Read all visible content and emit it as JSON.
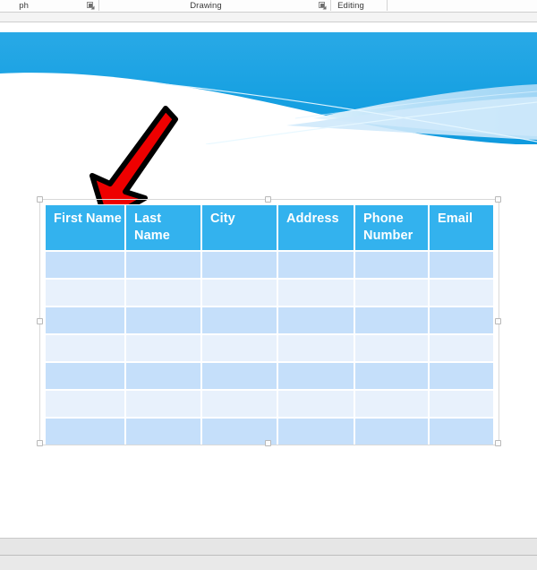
{
  "ribbon": {
    "groups": [
      {
        "label": "ph",
        "full_label": "Paragraph",
        "has_dialog_launcher": true
      },
      {
        "label": "Drawing",
        "full_label": "Drawing",
        "has_dialog_launcher": true
      },
      {
        "label": "Editing",
        "full_label": "Editing",
        "has_dialog_launcher": false
      }
    ],
    "dialog_launcher_icon": "dialog-box-launcher-icon"
  },
  "slide": {
    "theme_name": "blue-wave-banner",
    "background_color": "#ffffff",
    "banner": {
      "accent_color": "#1aa3e0",
      "accent_color_dark": "#0d97da",
      "accent_color_light": "#9fd5f5",
      "accent_color_pale": "#cfe9fb",
      "line_color": "#eaf7ff"
    },
    "annotation": {
      "shape": "arrow-down-left",
      "fill_color": "#ee0000",
      "outline_color": "#000000",
      "points_at": "First Name header cell"
    },
    "table": {
      "selected": true,
      "header_background": "#33b2ee",
      "header_text_color": "#ffffff",
      "band_dark": "#c5dffa",
      "band_light": "#e8f1fc",
      "gridline_color": "#ffffff",
      "headers": [
        "First Name",
        "Last Name",
        "City",
        "Address",
        "Phone Number",
        "Email"
      ],
      "rows": [
        [
          "",
          "",
          "",
          "",
          "",
          ""
        ],
        [
          "",
          "",
          "",
          "",
          "",
          ""
        ],
        [
          "",
          "",
          "",
          "",
          "",
          ""
        ],
        [
          "",
          "",
          "",
          "",
          "",
          ""
        ],
        [
          "",
          "",
          "",
          "",
          "",
          ""
        ],
        [
          "",
          "",
          "",
          "",
          "",
          ""
        ],
        [
          "",
          "",
          "",
          "",
          "",
          ""
        ]
      ],
      "row_count": 7,
      "column_count": 6,
      "selection_handles": [
        "top-left",
        "top-center",
        "top-right",
        "middle-left",
        "middle-right",
        "bottom-left",
        "bottom-center",
        "bottom-right"
      ]
    }
  }
}
